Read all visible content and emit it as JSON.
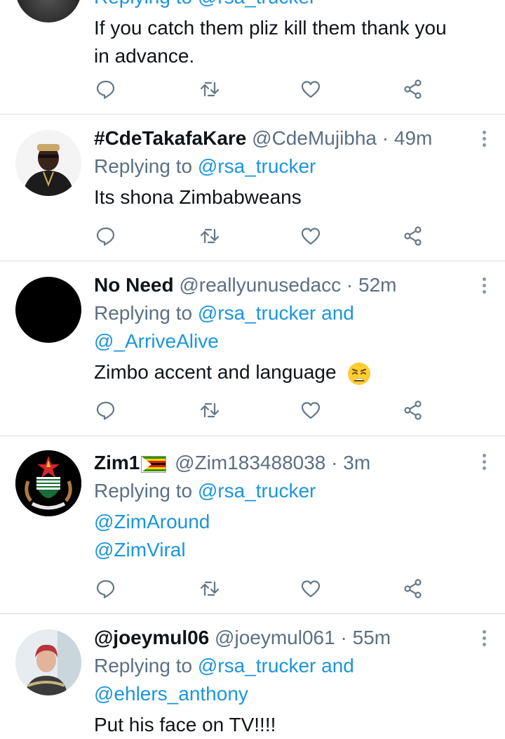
{
  "tweet0": {
    "reply_partial": "Replying to @rsa_trucker",
    "text_line1": "If you catch them pliz kill them thank you",
    "text_line2": "in advance."
  },
  "tweet1": {
    "name": "#CdeTakafaKare",
    "handle": "@CdeMujibha",
    "time": "49m",
    "reply_prefix": "Replying to",
    "reply_to": "@rsa_trucker",
    "text": "Its shona Zimbabweans"
  },
  "tweet2": {
    "name": "No Need",
    "handle": "@reallyunusedacc",
    "time": "52m",
    "reply_prefix": "Replying to",
    "reply_to": "@rsa_trucker and",
    "reply_to2": "@_ArriveAlive",
    "text": "Zimbo accent and language"
  },
  "tweet3": {
    "name": "Zim1",
    "handle": "@Zim183488038",
    "time": "3m",
    "reply_prefix": "Replying to",
    "reply_to": "@rsa_trucker",
    "text_line1": "@ZimAround",
    "text_line2": "@ZimViral"
  },
  "tweet4": {
    "name": "@joeymul06",
    "handle": "@joeymul061",
    "time": "55m",
    "reply_prefix": "Replying to",
    "reply_to": "@rsa_trucker and",
    "reply_to2": "@ehlers_anthony",
    "text": "Put his face on TV!!!!"
  },
  "separator": "·",
  "icons": {
    "reply": "reply-icon",
    "retweet": "retweet-icon",
    "like": "heart-icon",
    "share": "share-icon",
    "more": "more-vertical-icon"
  },
  "colors": {
    "link": "#1b95e0",
    "muted": "#5b7083",
    "icon": "#657786",
    "divider": "#d9dde1"
  }
}
